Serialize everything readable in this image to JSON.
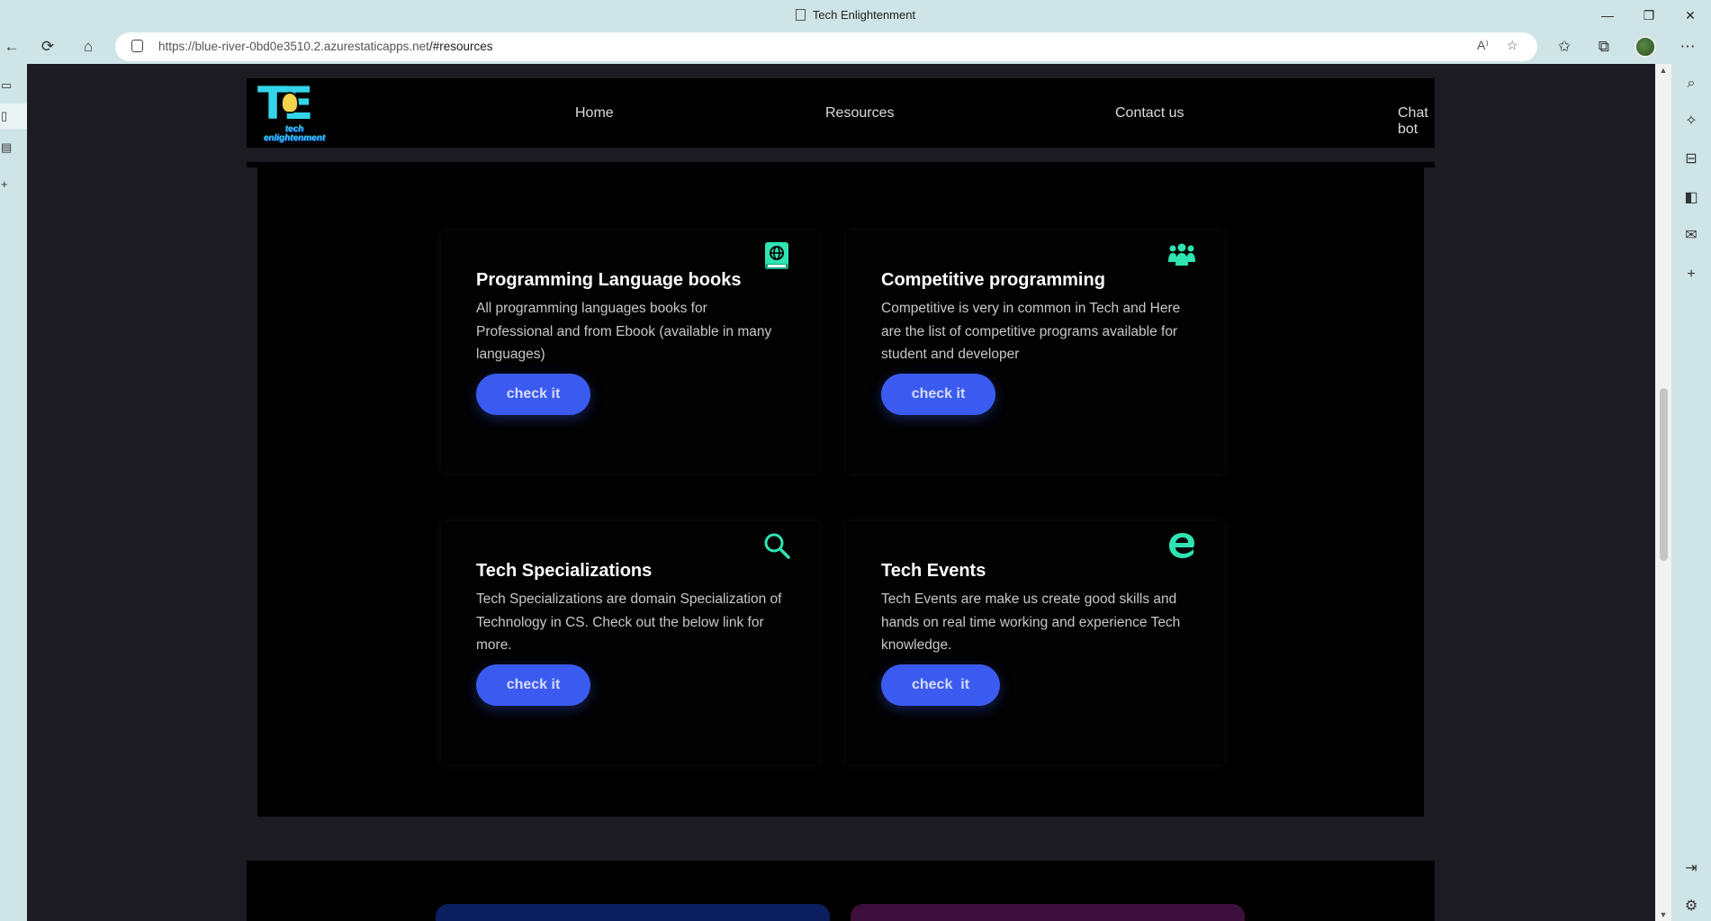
{
  "browser": {
    "window_title": "Tech Enlightenment",
    "url_host": "https://blue-river-0bd0e3510.2.azurestaticapps.net",
    "url_path": "/#resources",
    "controls": {
      "minimize": "—",
      "restore": "❐",
      "close": "✕"
    },
    "icons": [
      "back-icon",
      "reload-icon",
      "home-icon",
      "lock-icon",
      "read-aloud-icon",
      "favorite-add-icon",
      "favorites-icon",
      "collections-icon",
      "profile-avatar",
      "more-icon"
    ]
  },
  "site": {
    "logo": {
      "mark": "TE",
      "tagline_1": "tech",
      "tagline_2": "enlightenment"
    },
    "nav": [
      "Home",
      "Resources",
      "Contact us",
      "Chat bot"
    ]
  },
  "resources": {
    "cards": [
      {
        "title": "Programming Language books",
        "description": "All programming languages books for Professional and from Ebook (available in many languages)",
        "button": "check it",
        "icon": "book-globe-icon"
      },
      {
        "title": "Competitive programming",
        "description": "Competitive is very in common in Tech and Here are the list of competitive programs available for student and developer",
        "button": "check it",
        "icon": "people-group-icon"
      },
      {
        "title": "Tech Specializations",
        "description": "Tech Specializations are domain Specialization of Technology in CS. Check out the below link for more.",
        "button": "check it",
        "icon": "search-icon"
      },
      {
        "title": "Tech Events",
        "description": "Tech Events are make us create good skills and hands on real time working and experience Tech knowledge.",
        "button": "check  it",
        "icon": "edge-icon"
      }
    ]
  },
  "colors": {
    "accent_button": "#3b5bf0",
    "icon_teal": "#2fe3b2",
    "chrome": "#cfe4e6",
    "page_bg": "#1c1b22",
    "panel_blue": "#0b1f5e",
    "panel_purple": "#3d0f3d"
  }
}
